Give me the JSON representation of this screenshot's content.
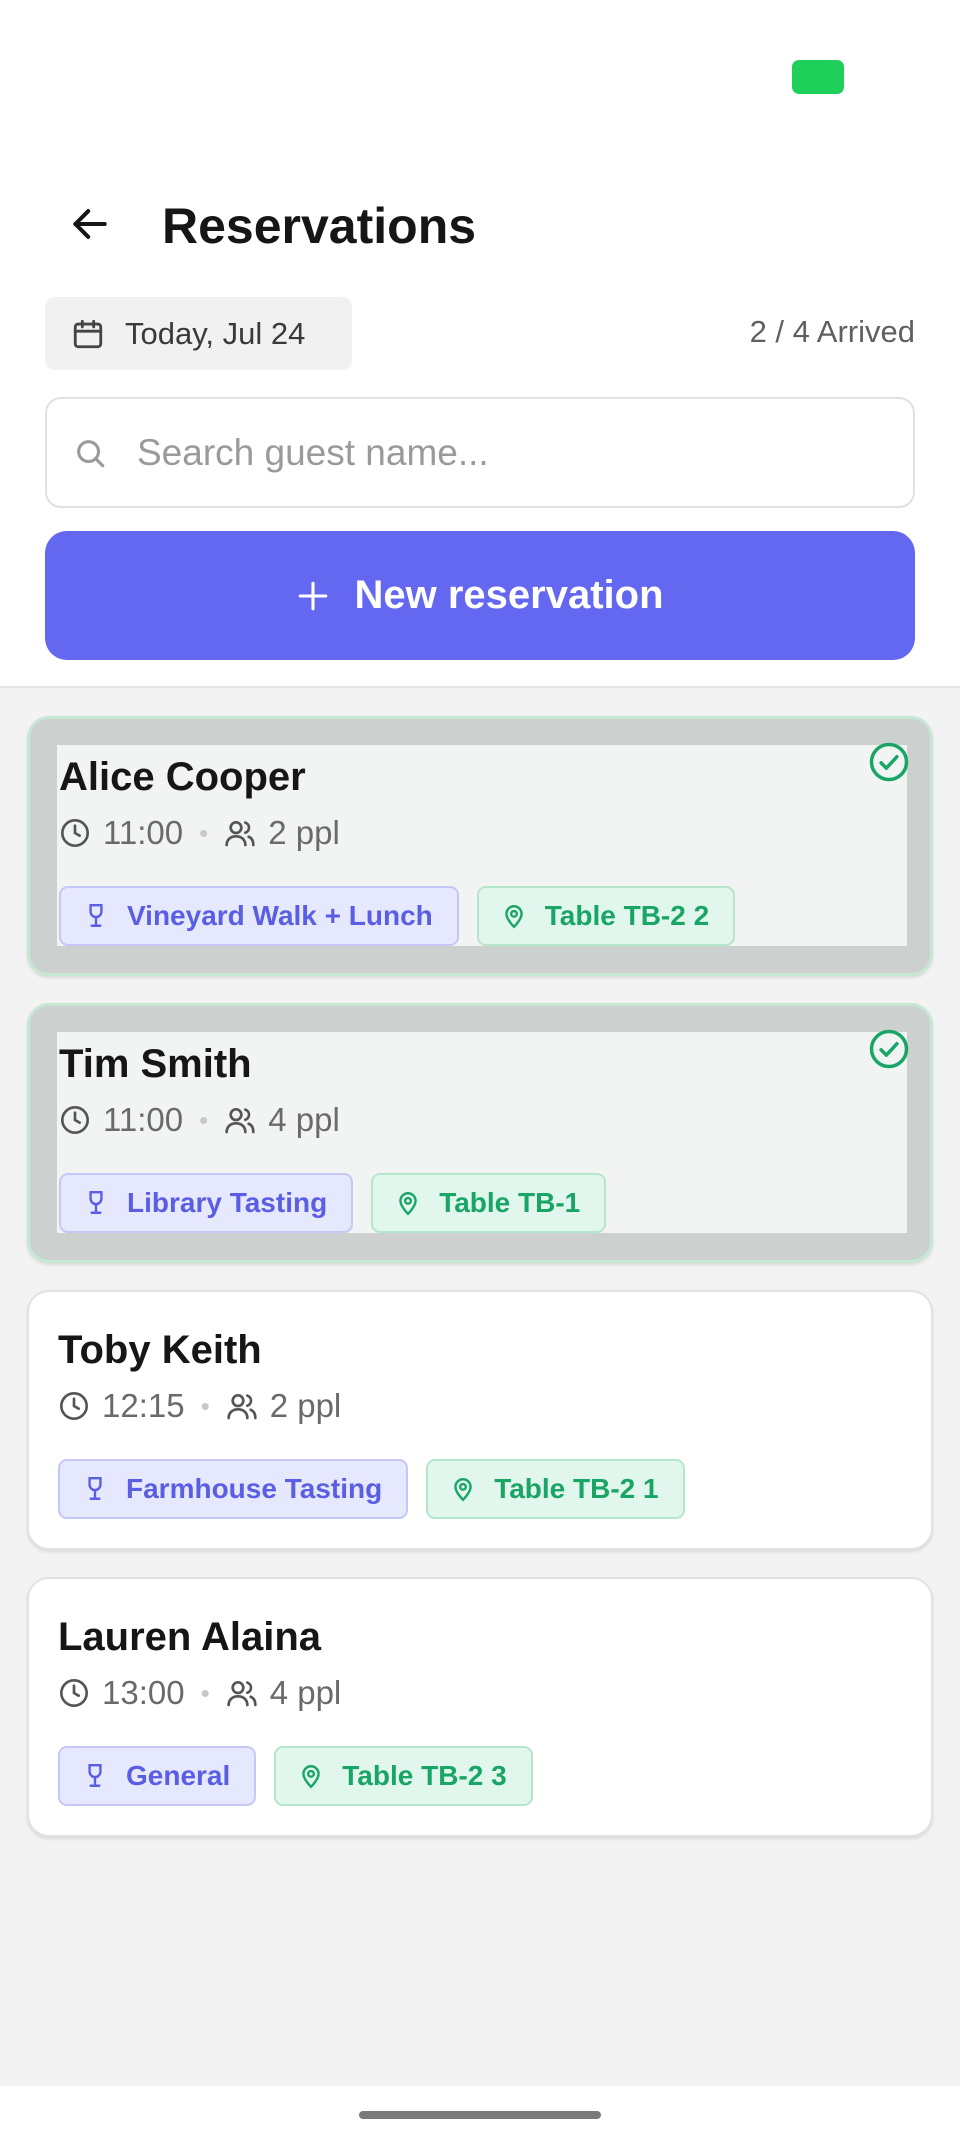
{
  "status_bar": {
    "battery_color": "#1ed05a"
  },
  "header": {
    "title": "Reservations",
    "back_icon": "arrow-left-icon"
  },
  "filters": {
    "date_label": "Today, Jul 24",
    "date_icon": "calendar-icon",
    "arrived_summary": "2 / 4 Arrived"
  },
  "search": {
    "placeholder": "Search guest name...",
    "value": "",
    "icon": "search-icon"
  },
  "new_button": {
    "label": "New reservation",
    "icon": "plus-icon",
    "color": "#6467f0"
  },
  "reservations": [
    {
      "name": "Alice Cooper",
      "time": "11:00",
      "party": "2 ppl",
      "experience": "Vineyard Walk + Lunch",
      "table": "Table TB-2 2",
      "arrived": true
    },
    {
      "name": "Tim Smith",
      "time": "11:00",
      "party": "4 ppl",
      "experience": "Library Tasting",
      "table": "Table TB-1",
      "arrived": true
    },
    {
      "name": "Toby Keith",
      "time": "12:15",
      "party": "2 ppl",
      "experience": "Farmhouse Tasting",
      "table": "Table TB-2 1",
      "arrived": false
    },
    {
      "name": "Lauren Alaina",
      "time": "13:00",
      "party": "4 ppl",
      "experience": "General",
      "table": "Table TB-2 3",
      "arrived": false
    }
  ],
  "colors": {
    "experience_tag": "#5a5ee3",
    "table_tag": "#18a565",
    "arrived_check": "#18a565"
  }
}
